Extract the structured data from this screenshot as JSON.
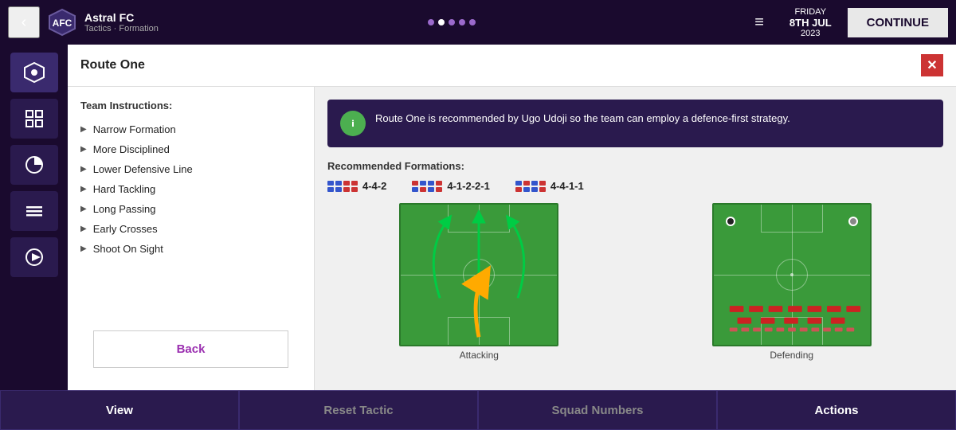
{
  "topbar": {
    "back_icon": "‹",
    "club_name": "Astral FC",
    "club_subtitle": "Tactics · Formation",
    "hamburger_icon": "≡",
    "date_day": "FRIDAY",
    "date_main": "8TH JUL",
    "date_year": "2023",
    "continue_label": "CONTINUE"
  },
  "modal": {
    "title": "Route One",
    "close_icon": "✕",
    "left_panel": {
      "instructions_label": "Team Instructions:",
      "instructions": [
        "Narrow Formation",
        "More Disciplined",
        "Lower Defensive Line",
        "Hard Tackling",
        "Long Passing",
        "Early Crosses",
        "Shoot On Sight"
      ],
      "back_label": "Back"
    },
    "right_panel": {
      "info_icon": "●",
      "info_text": "Route One is recommended by Ugo Udoji so the team can employ a defence-first strategy.",
      "formations_label": "Recommended Formations:",
      "formations": [
        {
          "label": "4-4-2"
        },
        {
          "label": "4-1-2-2-1"
        },
        {
          "label": "4-4-1-1"
        }
      ],
      "pitch_attacking_label": "Attacking",
      "pitch_defending_label": "Defending"
    }
  },
  "bottombar": {
    "view_label": "View",
    "reset_label": "Reset Tactic",
    "squad_label": "Squad Numbers",
    "actions_label": "Actions"
  },
  "sidebar": {
    "icons": [
      "⊕",
      "⚙",
      "◑",
      "≡",
      "▶"
    ]
  }
}
